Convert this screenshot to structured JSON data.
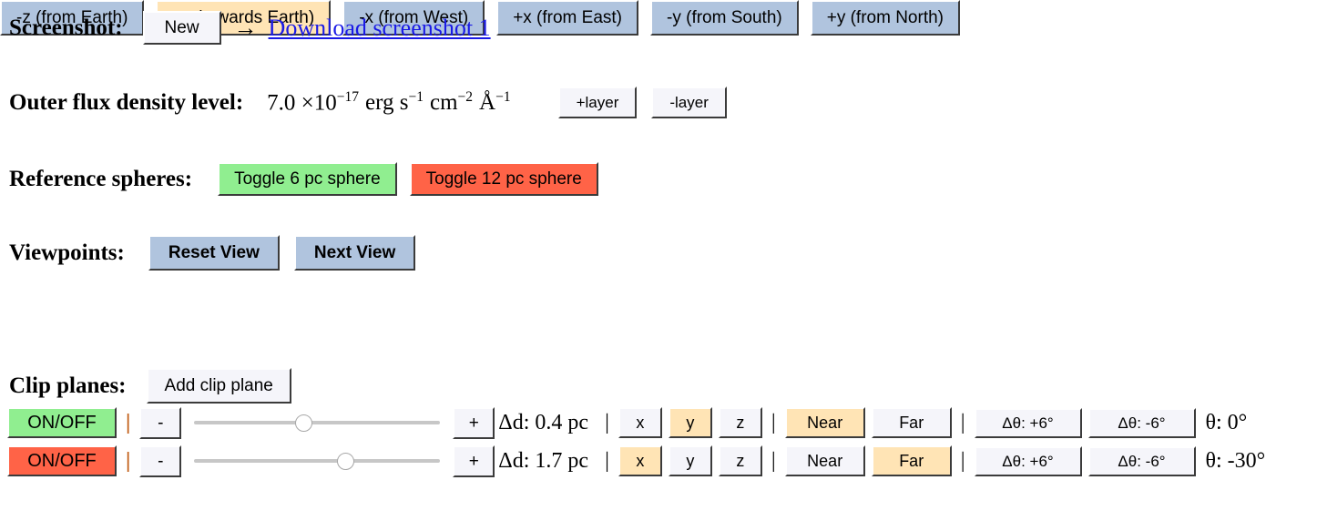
{
  "screenshot": {
    "label": "Screenshot:",
    "new_button": "New",
    "arrow": "→",
    "download_link": "Download screenshot 1"
  },
  "flux": {
    "label": "Outer flux density level:",
    "mantissa": "7.0 ×10",
    "exponent": "−17",
    "unit_erg": "erg s",
    "unit_erg_exp": "−1",
    "unit_cm": "cm",
    "unit_cm_exp": "−2",
    "unit_angstrom": "Å",
    "unit_angstrom_exp": "−1",
    "add_layer": "+layer",
    "remove_layer": "-layer"
  },
  "spheres": {
    "label": "Reference spheres:",
    "toggle_6pc": "Toggle 6 pc sphere",
    "toggle_12pc": "Toggle 12 pc sphere",
    "color_6pc": "#90EE90",
    "color_12pc": "#FF6347"
  },
  "viewpoints": {
    "label": "Viewpoints:",
    "reset_view": "Reset View",
    "next_view": "Next View",
    "axes": [
      {
        "label": "-z (from Earth)",
        "active": false
      },
      {
        "label": "+z (towards Earth)",
        "active": true
      },
      {
        "label": "-x (from West)",
        "active": false
      },
      {
        "label": "+x (from East)",
        "active": false
      },
      {
        "label": "-y (from South)",
        "active": false
      },
      {
        "label": "+y (from North)",
        "active": false
      }
    ],
    "color_inactive": "#B0C4DE",
    "color_active": "#FFE4B5"
  },
  "clip_planes": {
    "label": "Clip planes:",
    "add_button": "Add clip plane",
    "separator": "|",
    "decrement": "-",
    "increment": "+",
    "axis_options": [
      "x",
      "y",
      "z"
    ],
    "near_label": "Near",
    "far_label": "Far",
    "theta_plus": "Δθ: +6°",
    "theta_minus": "Δθ: -6°",
    "color_on": "#90EE90",
    "color_off": "#FF6347",
    "color_selected": "#FFE4B5",
    "rows": [
      {
        "onoff_label": "ON/OFF",
        "onoff_state": "on",
        "slider_percent": 44,
        "delta_d": "Δd: 0.4 pc",
        "axis_selected": "y",
        "side_selected": "Near",
        "theta_value": "θ: 0°"
      },
      {
        "onoff_label": "ON/OFF",
        "onoff_state": "off",
        "slider_percent": 61,
        "delta_d": "Δd: 1.7 pc",
        "axis_selected": "x",
        "side_selected": "Far",
        "theta_value": "θ: -30°"
      }
    ]
  }
}
